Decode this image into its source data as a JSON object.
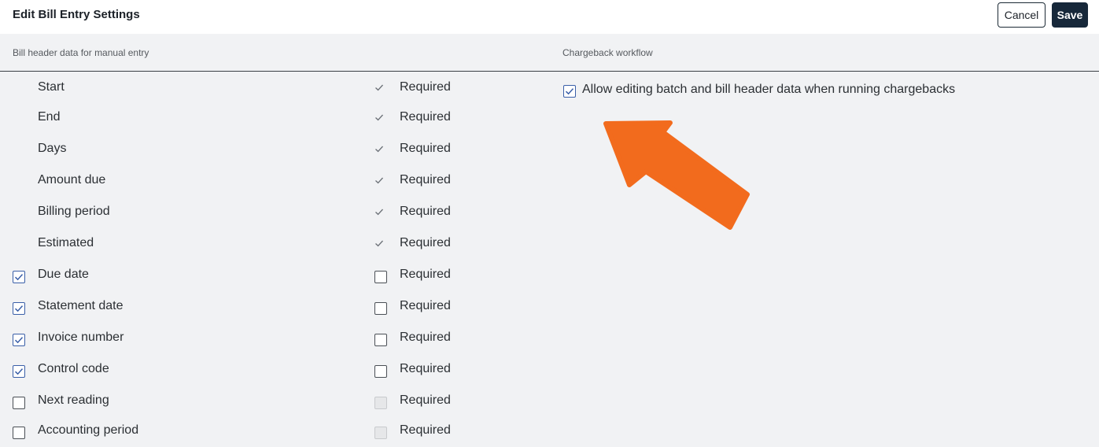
{
  "header": {
    "title": "Edit Bill Entry Settings",
    "cancel_label": "Cancel",
    "save_label": "Save"
  },
  "left_section": {
    "title": "Bill header data for manual entry",
    "fields": [
      {
        "label": "Start",
        "enabled": "fixed",
        "required": "fixed",
        "required_label": "Required"
      },
      {
        "label": "End",
        "enabled": "fixed",
        "required": "fixed",
        "required_label": "Required"
      },
      {
        "label": "Days",
        "enabled": "fixed",
        "required": "fixed",
        "required_label": "Required"
      },
      {
        "label": "Amount due",
        "enabled": "fixed",
        "required": "fixed",
        "required_label": "Required"
      },
      {
        "label": "Billing period",
        "enabled": "fixed",
        "required": "fixed",
        "required_label": "Required"
      },
      {
        "label": "Estimated",
        "enabled": "fixed",
        "required": "fixed",
        "required_label": "Required"
      },
      {
        "label": "Due date",
        "enabled": "checked",
        "required": "unchecked",
        "required_label": "Required"
      },
      {
        "label": "Statement date",
        "enabled": "checked",
        "required": "unchecked",
        "required_label": "Required"
      },
      {
        "label": "Invoice number",
        "enabled": "checked",
        "required": "unchecked",
        "required_label": "Required"
      },
      {
        "label": "Control code",
        "enabled": "checked",
        "required": "unchecked",
        "required_label": "Required"
      },
      {
        "label": "Next reading",
        "enabled": "unchecked",
        "required": "disabled",
        "required_label": "Required"
      },
      {
        "label": "Accounting period",
        "enabled": "unchecked",
        "required": "disabled",
        "required_label": "Required"
      }
    ]
  },
  "right_section": {
    "title": "Chargeback workflow",
    "option_label": "Allow editing batch and bill header data when running chargebacks",
    "option_checked": true
  },
  "colors": {
    "accent_check": "#3a5fa8",
    "save_button": "#17283a",
    "arrow": "#f26b1d"
  }
}
